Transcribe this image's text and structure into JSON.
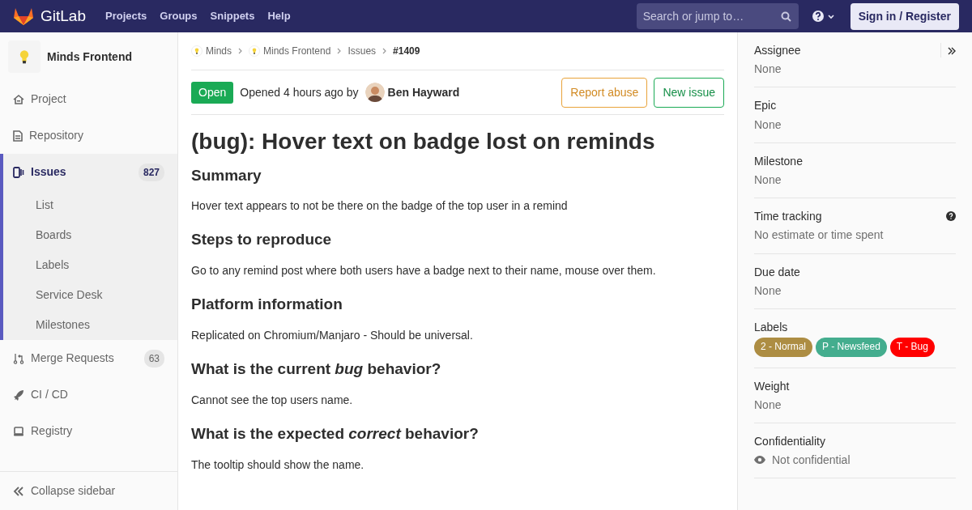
{
  "navbar": {
    "brand": "GitLab",
    "links": [
      "Projects",
      "Groups",
      "Snippets",
      "Help"
    ],
    "search": {
      "placeholder": "Search or jump to…"
    },
    "sign_in": "Sign in / Register"
  },
  "sidebar": {
    "project": "Minds Frontend",
    "items": [
      {
        "label": "Project",
        "selected": false
      },
      {
        "label": "Repository",
        "selected": false
      },
      {
        "label": "Issues",
        "selected": true,
        "count": "827",
        "children": [
          {
            "label": "List"
          },
          {
            "label": "Boards"
          },
          {
            "label": "Labels"
          },
          {
            "label": "Service Desk"
          },
          {
            "label": "Milestones"
          }
        ]
      },
      {
        "label": "Merge Requests",
        "selected": false,
        "count": "63"
      },
      {
        "label": "CI / CD",
        "selected": false
      },
      {
        "label": "Registry",
        "selected": false
      }
    ],
    "collapse": "Collapse sidebar"
  },
  "breadcrumbs": [
    {
      "label": "Minds",
      "avatar": true,
      "current": false
    },
    {
      "label": "Minds Frontend",
      "avatar": true,
      "current": false
    },
    {
      "label": "Issues",
      "avatar": false,
      "current": false
    },
    {
      "label": "#1409",
      "avatar": false,
      "current": true
    }
  ],
  "issue": {
    "status": "Open",
    "opened": "Opened 4 hours ago by",
    "author": "Ben Hayward",
    "buttons": [
      {
        "label": "Report abuse",
        "kind": "warning"
      },
      {
        "label": "New issue",
        "kind": "success"
      }
    ],
    "title": "(bug): Hover text on badge lost on reminds",
    "body": [
      {
        "kind": "heading",
        "text": "Summary"
      },
      {
        "kind": "paragraph",
        "text": "Hover text appears to not be there on the badge of the top user in a remind"
      },
      {
        "kind": "heading",
        "text": "Steps to reproduce"
      },
      {
        "kind": "paragraph",
        "text": "Go to any remind post where both users have a badge next to their name, mouse over them."
      },
      {
        "kind": "heading",
        "text": "Platform information"
      },
      {
        "kind": "paragraph",
        "text": "Replicated on Chromium/Manjaro - Should be universal."
      },
      {
        "kind": "heading",
        "text": "What is the current *bug* behavior?"
      },
      {
        "kind": "paragraph",
        "text": "Cannot see the top users name."
      },
      {
        "kind": "heading",
        "text": "What is the expected *correct* behavior?"
      },
      {
        "kind": "paragraph",
        "text": "The tooltip should show the name."
      }
    ]
  },
  "right_sidebar": [
    {
      "kind": "text",
      "label": "Assignee",
      "value": "None",
      "collapse": true
    },
    {
      "kind": "text",
      "label": "Epic",
      "value": "None"
    },
    {
      "kind": "text",
      "label": "Milestone",
      "value": "None"
    },
    {
      "kind": "text",
      "label": "Time tracking",
      "value": "No estimate or time spent",
      "help": true
    },
    {
      "kind": "text",
      "label": "Due date",
      "value": "None"
    },
    {
      "kind": "labels",
      "label": "Labels",
      "labels": [
        {
          "text": "2 - Normal",
          "color": "#ad8d43"
        },
        {
          "text": "P - Newsfeed",
          "color": "#44ad8e"
        },
        {
          "text": "T - Bug",
          "color": "#ff0000"
        }
      ]
    },
    {
      "kind": "text",
      "label": "Weight",
      "value": "None"
    },
    {
      "kind": "confidential",
      "label": "Confidentiality",
      "value": "Not confidential"
    }
  ]
}
